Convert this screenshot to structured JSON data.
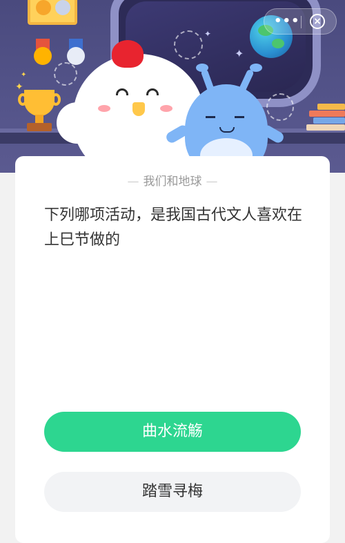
{
  "header": {
    "menu_icon": "more-dots-icon",
    "close_icon": "close-icon",
    "menu_glyph": "•••",
    "close_glyph": "×"
  },
  "quiz": {
    "category": "我们和地球",
    "question": "下列哪项活动，是我国古代文人喜欢在上巳节做的",
    "options": [
      {
        "label": "曲水流觞",
        "state": "correct"
      },
      {
        "label": "踏雪寻梅",
        "state": "default"
      }
    ]
  },
  "colors": {
    "accent": "#2dd690",
    "banner": "#54548a",
    "option_default_bg": "#f2f3f5"
  }
}
